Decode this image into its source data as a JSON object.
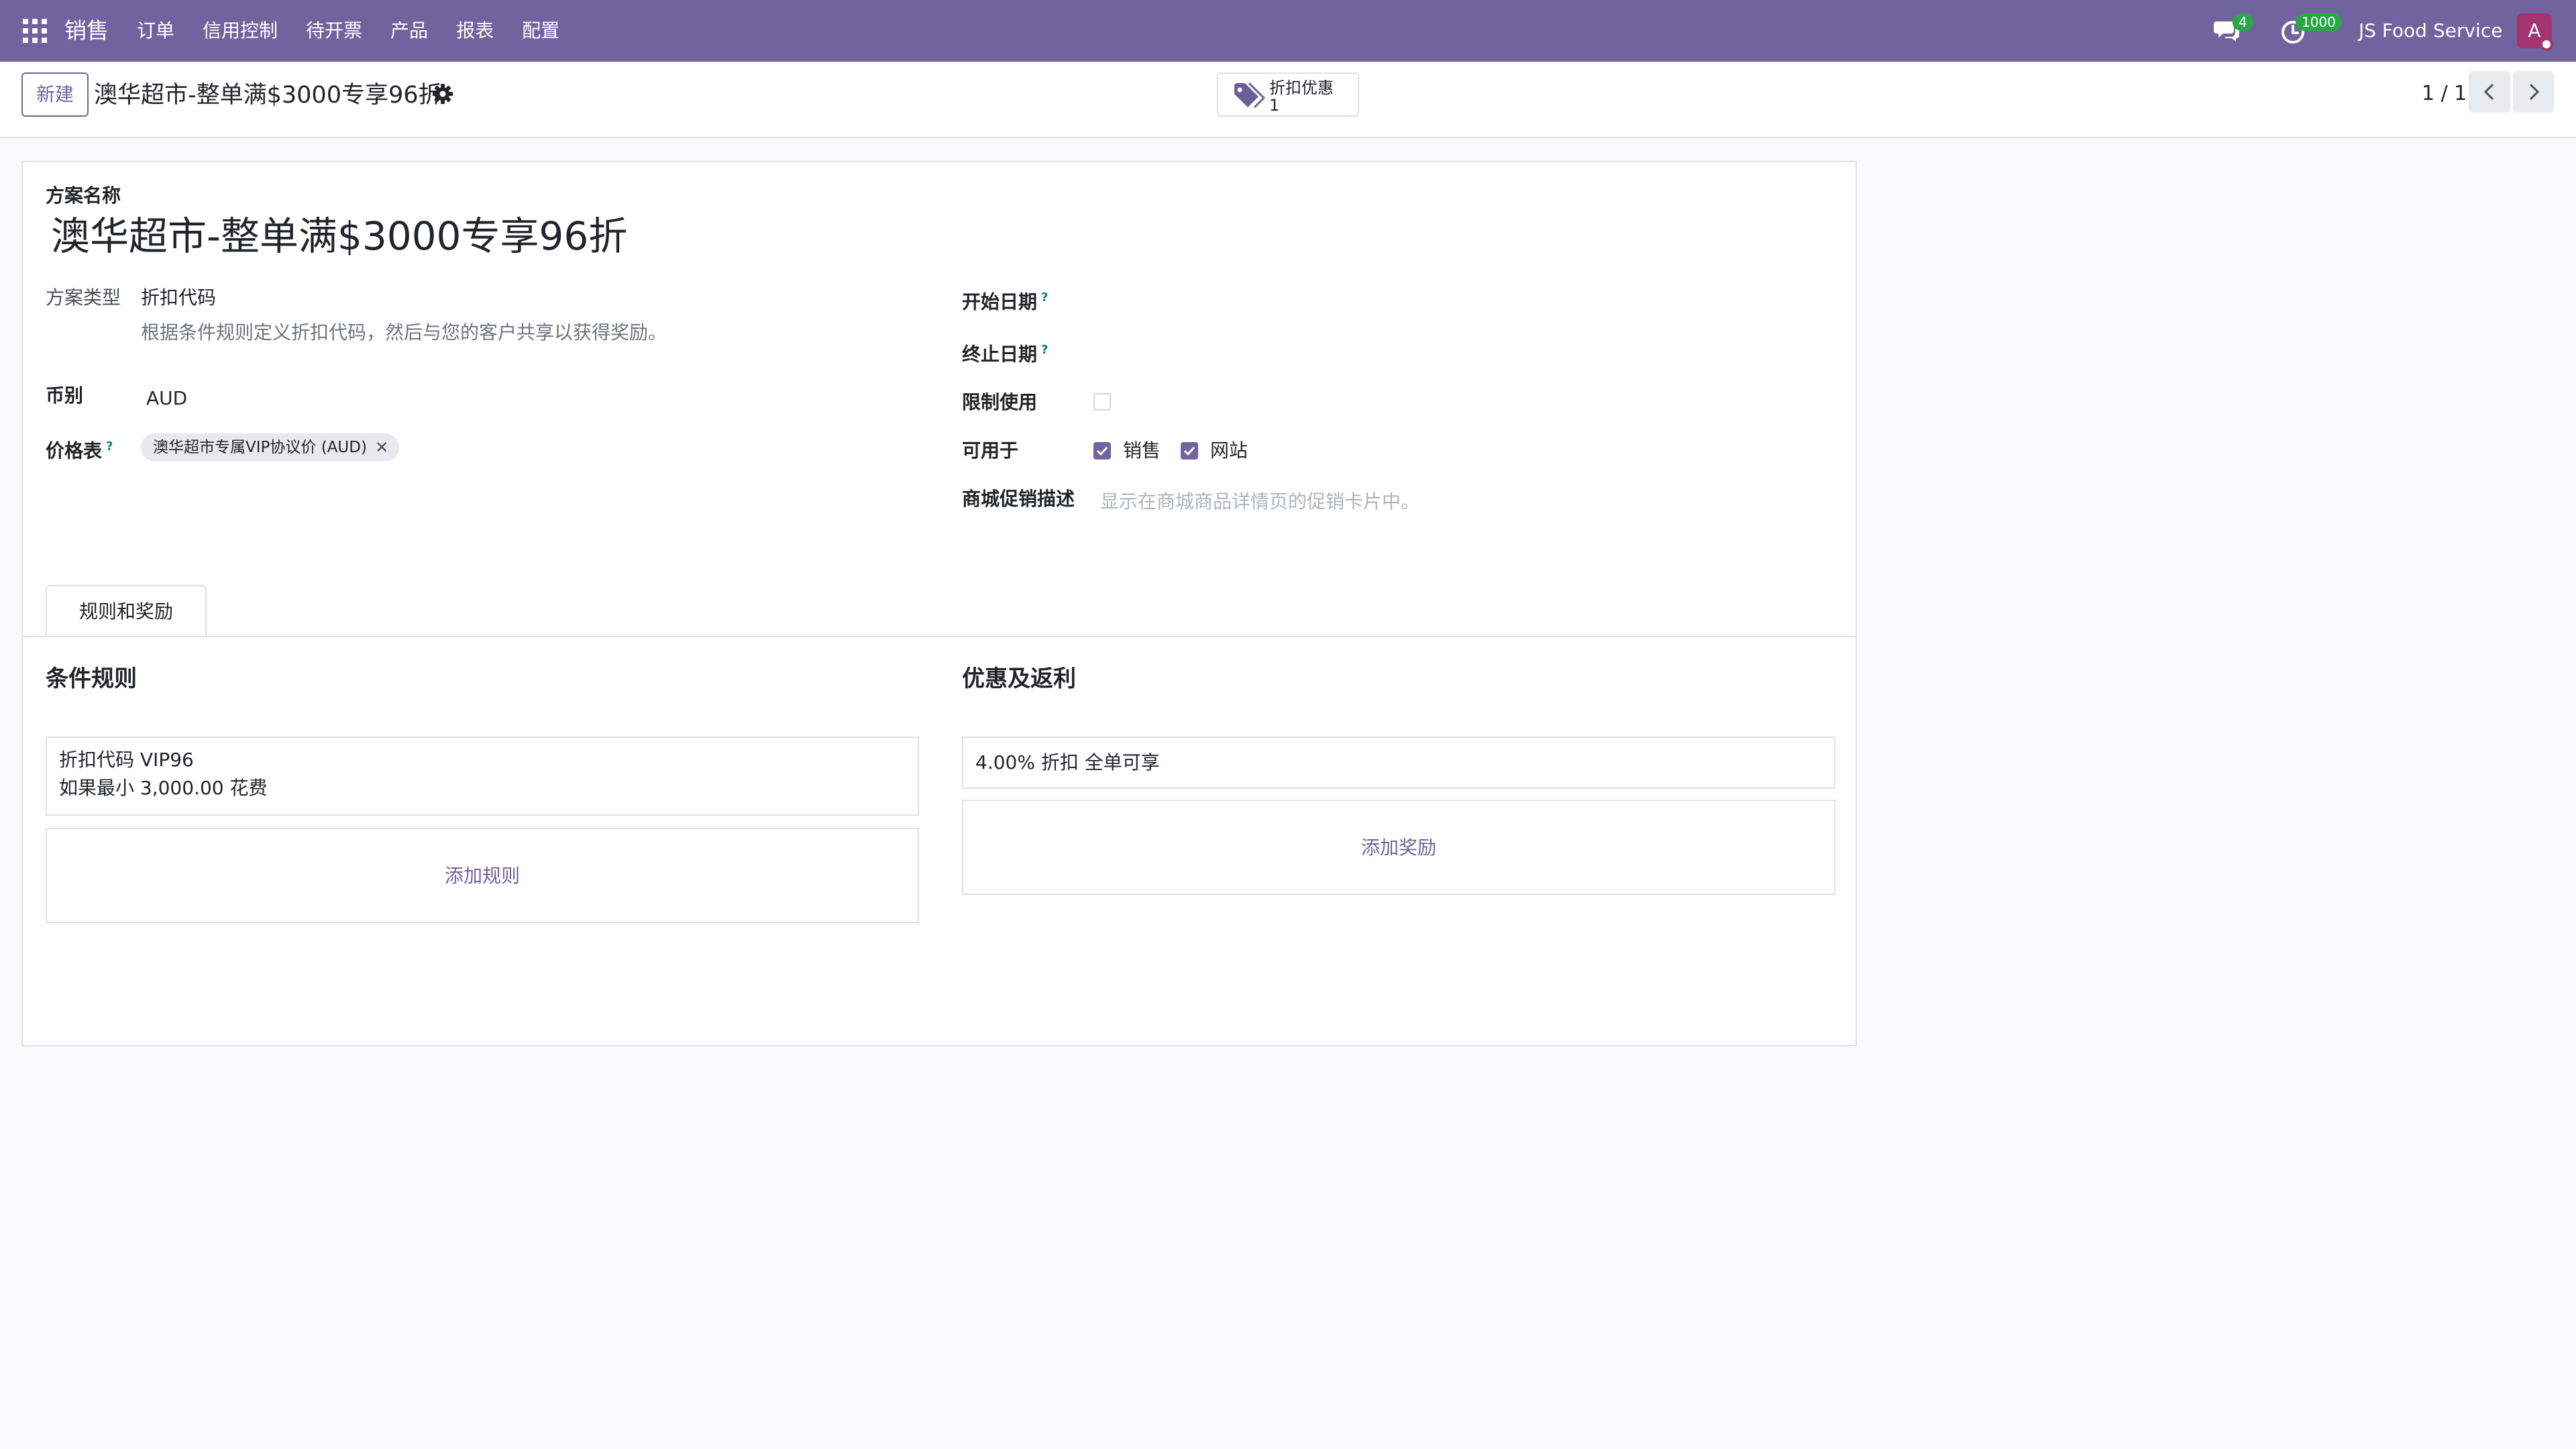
{
  "navbar": {
    "app_name": "销售",
    "menu": [
      "订单",
      "信用控制",
      "待开票",
      "产品",
      "报表",
      "配置"
    ],
    "chat_count": "4",
    "activity_count": "1000",
    "company": "JS Food Service",
    "avatar_initial": "A"
  },
  "control": {
    "new_button": "新建",
    "breadcrumb": "澳华超市-整单满$3000专享96折",
    "smart_button": {
      "label": "折扣优惠",
      "value": "1"
    },
    "pager": "1 / 1"
  },
  "form": {
    "name_label": "方案名称",
    "name_value": "澳华超市-整单满$3000专享96折",
    "left": {
      "type_label": "方案类型",
      "type_value": "折扣代码",
      "type_help": "根据条件规则定义折扣代码，然后与您的客户共享以获得奖励。",
      "currency_label": "币别",
      "currency_value": "AUD",
      "pricelist_label": "价格表",
      "pricelist_help": "?",
      "pricelist_tag": "澳华超市专属VIP协议价 (AUD)"
    },
    "right": {
      "start_label": "开始日期",
      "start_help": "?",
      "end_label": "终止日期",
      "end_help": "?",
      "limit_label": "限制使用",
      "available_label": "可用于",
      "available_sales": "销售",
      "available_website": "网站",
      "ecommerce_label": "商城促销描述",
      "ecommerce_placeholder": "显示在商城商品详情页的促销卡片中。"
    },
    "tab_label": "规则和奖励",
    "rules": {
      "title": "条件规则",
      "rule_line1": "折扣代码 VIP96",
      "rule_line2": "如果最小 3,000.00 花费",
      "add_label": "添加规则"
    },
    "rewards": {
      "title": "优惠及返利",
      "reward_line": "4.00% 折扣 全单可享",
      "add_label": "添加奖励"
    }
  },
  "colors": {
    "brand": "#71639e",
    "badge": "#28a745",
    "avatar": "#a2346f"
  }
}
